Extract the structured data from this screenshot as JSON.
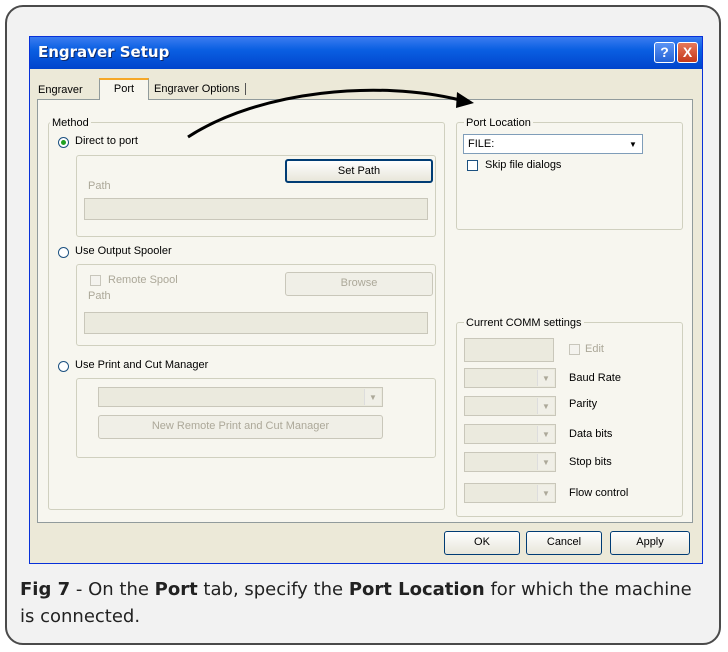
{
  "window": {
    "title": "Engraver Setup",
    "help_glyph": "?",
    "close_glyph": "X"
  },
  "tabs": {
    "engraver": "Engraver",
    "port": "Port",
    "options": "Engraver Options"
  },
  "method": {
    "group_label": "Method",
    "direct_label": "Direct to port",
    "set_path_button": "Set Path",
    "path_label": "Path",
    "spooler_label": "Use Output Spooler",
    "remote_spool_label": "Remote Spool",
    "browse_button": "Browse",
    "spooler_path_label": "Path",
    "pcm_label": "Use Print and Cut Manager",
    "new_remote_button": "New Remote Print and Cut Manager"
  },
  "port_location": {
    "group_label": "Port Location",
    "value": "FILE:",
    "skip_label": "Skip file dialogs"
  },
  "comm": {
    "group_label": "Current COMM settings",
    "edit_label": "Edit",
    "baud_label": "Baud Rate",
    "parity_label": "Parity",
    "data_bits_label": "Data bits",
    "stop_bits_label": "Stop bits",
    "flow_label": "Flow control"
  },
  "buttons": {
    "ok": "OK",
    "cancel": "Cancel",
    "apply": "Apply"
  },
  "caption": {
    "fig": "Fig 7",
    "t1": " - On the ",
    "b1": "Port",
    "t2": " tab, specify the ",
    "b2": "Port Location",
    "t3": " for which the machine is connected."
  }
}
